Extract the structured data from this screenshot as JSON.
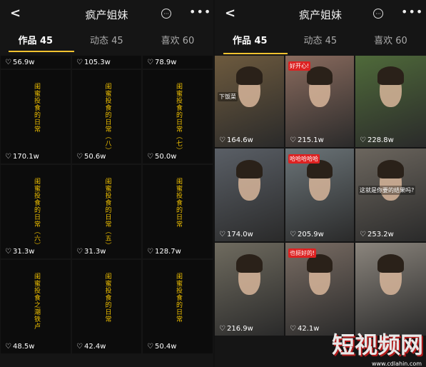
{
  "left": {
    "title": "疯产姐妹",
    "tabs": [
      "作品 45",
      "动态 45",
      "喜欢 60"
    ],
    "top_likes": [
      "56.9w",
      "105.3w",
      "78.9w"
    ],
    "tiles": [
      {
        "text": "闺蜜投食的日常",
        "likes": "170.1w"
      },
      {
        "text": "闺蜜投食的日常（八）",
        "likes": "50.6w"
      },
      {
        "text": "闺蜜投食的日常（七）",
        "likes": "50.0w"
      },
      {
        "text": "闺蜜投食的日常（六）",
        "likes": "31.3w"
      },
      {
        "text": "闺蜜投食的日常（五）",
        "likes": "31.3w"
      },
      {
        "text": "闺蜜投食的日常",
        "likes": "128.7w"
      },
      {
        "text": "闺蜜投食之潮铁卢",
        "likes": "48.5w"
      },
      {
        "text": "闺蜜投食的日常",
        "likes": "42.4w"
      },
      {
        "text": "闺蜜投食的日常",
        "likes": "50.4w"
      }
    ]
  },
  "right": {
    "title": "疯产姐妹",
    "tabs": [
      "作品 45",
      "动态 45",
      "喜欢 60"
    ],
    "tiles": [
      {
        "caption": "下饭菜",
        "likes": "164.6w",
        "color": "#6d5a3e"
      },
      {
        "caption": "好开心!",
        "likes": "215.1w",
        "color": "#8a6b5e"
      },
      {
        "caption": "",
        "likes": "228.8w",
        "color": "#4f6a3a"
      },
      {
        "caption": "",
        "likes": "174.0w",
        "color": "#5a5f66"
      },
      {
        "caption": "哈哈哈哈哈",
        "likes": "205.9w",
        "color": "#6b7478"
      },
      {
        "caption": "这就是你要的结果吗?",
        "likes": "253.2w",
        "color": "#6c665e"
      },
      {
        "caption": "",
        "likes": "216.9w",
        "color": "#6f6b5f"
      },
      {
        "caption": "也挺好的!",
        "likes": "42.1w",
        "color": "#7a6d64"
      },
      {
        "caption": "",
        "likes": "",
        "color": "#8b857d"
      }
    ],
    "watermark": "短视频网",
    "watermark_url": "www.cdlahin.com"
  }
}
